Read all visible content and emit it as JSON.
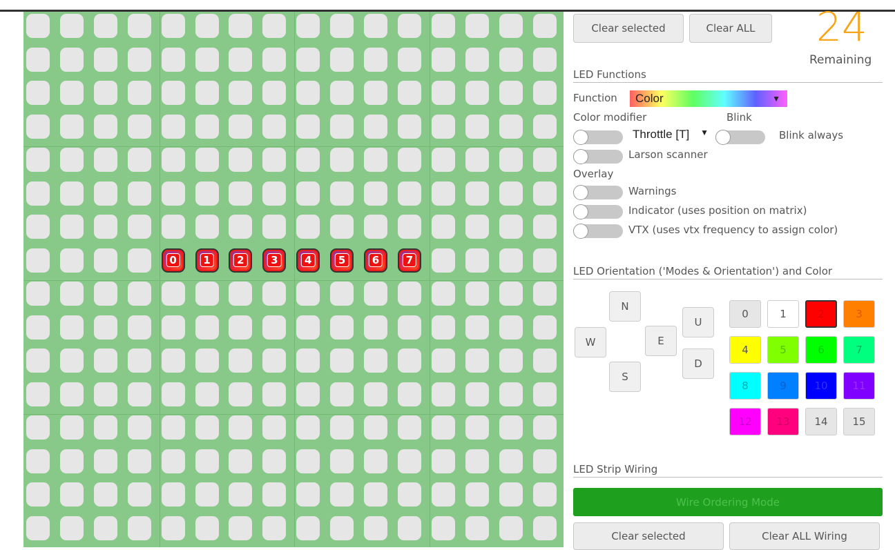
{
  "top_buttons": {
    "clear_selected": "Clear selected",
    "clear_all": "Clear ALL"
  },
  "remaining": {
    "count": "24",
    "label": "Remaining"
  },
  "led_functions": {
    "title": "LED Functions",
    "function_label": "Function",
    "function_value": "Color",
    "color_modifier_label": "Color modifier",
    "throttle_value": "Throttle [T]",
    "blink_label": "Blink",
    "blink_always": "Blink always",
    "larson_scanner": "Larson scanner",
    "overlay_label": "Overlay",
    "warnings": "Warnings",
    "indicator": "Indicator (uses position on matrix)",
    "vtx": "VTX (uses vtx frequency to assign color)"
  },
  "orientation": {
    "title": "LED Orientation ('Modes & Orientation') and Color",
    "directions": {
      "N": "N",
      "W": "W",
      "E": "E",
      "S": "S",
      "U": "U",
      "D": "D"
    }
  },
  "colors": [
    {
      "label": "0",
      "bg": "#e6e6e6",
      "fg": "#555"
    },
    {
      "label": "1",
      "bg": "#ffffff",
      "fg": "#555"
    },
    {
      "label": "2",
      "bg": "#ff0000",
      "fg": "#d80000"
    },
    {
      "label": "3",
      "bg": "#ff7f00",
      "fg": "#dd5a00"
    },
    {
      "label": "4",
      "bg": "#ffff00",
      "fg": "#555"
    },
    {
      "label": "5",
      "bg": "#7fff00",
      "fg": "#55c000"
    },
    {
      "label": "6",
      "bg": "#00ff00",
      "fg": "#00d000"
    },
    {
      "label": "7",
      "bg": "#00ff7f",
      "fg": "#00b060"
    },
    {
      "label": "8",
      "bg": "#00ffff",
      "fg": "#00b0b0"
    },
    {
      "label": "9",
      "bg": "#007fff",
      "fg": "#0060d0"
    },
    {
      "label": "10",
      "bg": "#0000ff",
      "fg": "#3030ff"
    },
    {
      "label": "11",
      "bg": "#7f00ff",
      "fg": "#9a30ff"
    },
    {
      "label": "12",
      "bg": "#ff00ff",
      "fg": "#d000d0"
    },
    {
      "label": "13",
      "bg": "#ff007f",
      "fg": "#d00060"
    },
    {
      "label": "14",
      "bg": "#e6e6e6",
      "fg": "#555"
    },
    {
      "label": "15",
      "bg": "#e6e6e6",
      "fg": "#555"
    }
  ],
  "wiring": {
    "title": "LED Strip Wiring",
    "wire_ordering_mode": "Wire Ordering Mode",
    "clear_selected": "Clear selected",
    "clear_all_wiring": "Clear ALL Wiring"
  },
  "grid": {
    "rows": 16,
    "cols": 16,
    "wired": [
      {
        "row": 7,
        "col": 4,
        "label": "0"
      },
      {
        "row": 7,
        "col": 5,
        "label": "1"
      },
      {
        "row": 7,
        "col": 6,
        "label": "2"
      },
      {
        "row": 7,
        "col": 7,
        "label": "3"
      },
      {
        "row": 7,
        "col": 8,
        "label": "4"
      },
      {
        "row": 7,
        "col": 9,
        "label": "5"
      },
      {
        "row": 7,
        "col": 10,
        "label": "6"
      },
      {
        "row": 7,
        "col": 11,
        "label": "7"
      }
    ]
  }
}
